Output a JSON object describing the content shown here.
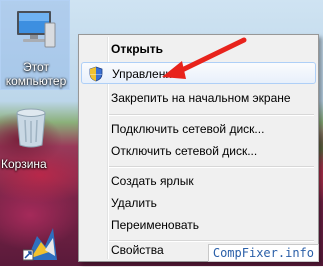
{
  "desktop": {
    "icons": [
      {
        "label": "Этот\nкомпьютер",
        "icon": "computer-icon"
      },
      {
        "label": "Корзина",
        "icon": "recycle-bin-icon"
      },
      {
        "label": "",
        "icon": "shortcut-icon"
      }
    ]
  },
  "context_menu": {
    "items": [
      {
        "label": "Открыть",
        "bold": true
      },
      {
        "label": "Управление",
        "icon": "uac-shield-icon",
        "highlighted": true
      },
      {
        "label": "Закрепить на начальном экране"
      },
      {
        "label": "Подключить сетевой диск..."
      },
      {
        "label": "Отключить сетевой диск..."
      },
      {
        "label": "Создать ярлык"
      },
      {
        "label": "Удалить"
      },
      {
        "label": "Переименовать"
      },
      {
        "label": "Свойства"
      }
    ]
  },
  "annotation": {
    "icon": "red-arrow-icon",
    "color": "#e8231c"
  },
  "watermark": {
    "text": "CompFixer.info"
  },
  "colors": {
    "menu_bg": "#f0f0f0",
    "highlight_border": "#aecff7",
    "arrow": "#e8231c"
  }
}
